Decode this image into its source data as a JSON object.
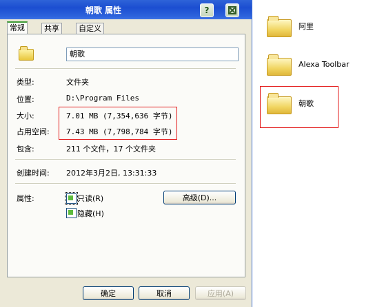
{
  "dialog": {
    "title": "朝歌 属性",
    "help_label": "?",
    "tabs": [
      "常规",
      "共享",
      "自定义"
    ],
    "name_value": "朝歌",
    "fields": {
      "type_label": "类型:",
      "type_value": "文件夹",
      "location_label": "位置:",
      "location_value": "D:\\Program Files",
      "size_label": "大小:",
      "size_value": "7.01 MB (7,354,636 字节)",
      "disk_size_label": "占用空间:",
      "disk_size_value": "7.43 MB (7,798,784 字节)",
      "contains_label": "包含:",
      "contains_value": "211 个文件，17 个文件夹",
      "created_label": "创建时间:",
      "created_value": "2012年3月2日, 13:31:33",
      "attributes_label": "属性:"
    },
    "attributes": {
      "readonly": "只读(R)",
      "hidden": "隐藏(H)"
    },
    "advanced_button": "高级(D)...",
    "buttons": {
      "ok": "确定",
      "cancel": "取消",
      "apply": "应用(A)"
    }
  },
  "explorer": {
    "items": [
      "阿里",
      "Alexa Toolbar",
      "朝歌"
    ]
  }
}
